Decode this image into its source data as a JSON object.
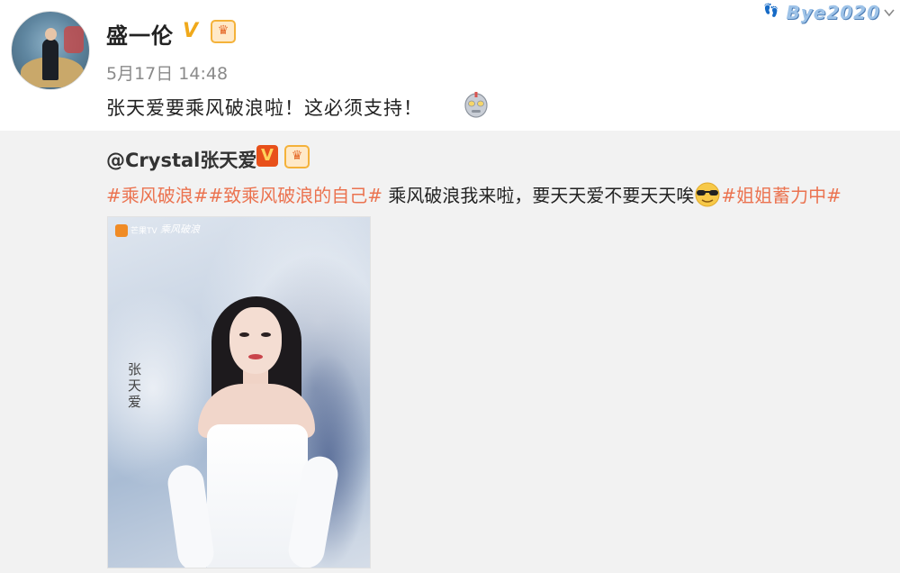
{
  "post": {
    "author_name": "盛一伦",
    "verified_mark": "V",
    "crown_mark": "♛",
    "time": "5月17日 14:48",
    "text": "张天爱要乘风破浪啦！这必须支持！"
  },
  "watermark": {
    "text": "Bye2020",
    "feet": "👣"
  },
  "quoted": {
    "author_name": "@Crystal张天爱",
    "verified_mark": "V",
    "crown_mark": "♛",
    "tag1": "#乘风破浪#",
    "tag2": "#致乘风破浪的自己#",
    "body": " 乘风破浪我来啦，要天天爱不要天天唉",
    "tag3": "#姐姐蓄力中#",
    "image": {
      "channel_logo_text": "芒果TV",
      "show_logo_text": "乘风破浪",
      "signature": "张天爱"
    }
  },
  "colors": {
    "link": "#eb7350",
    "quoted_bg": "#f2f2f2",
    "verified_orange": "#f0a91b"
  },
  "icons": [
    "avatar",
    "verified-v-icon",
    "crown-badge-icon",
    "robot-emoji-icon",
    "sunglasses-emoji-icon",
    "chevron-down-icon"
  ]
}
